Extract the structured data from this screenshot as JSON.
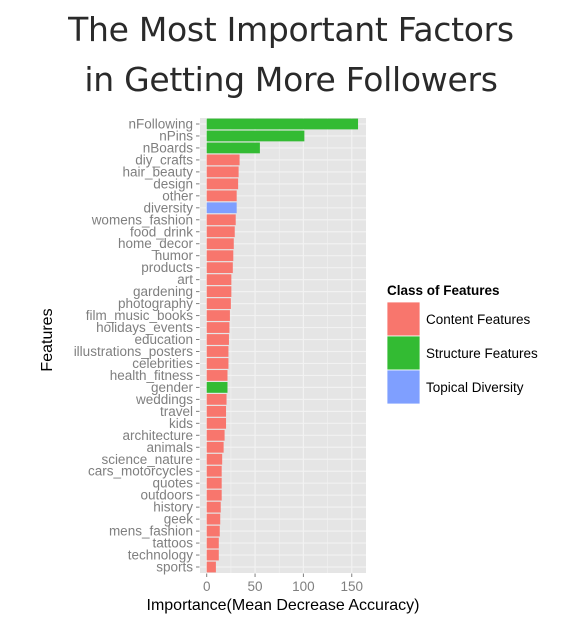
{
  "title_lines": [
    "The Most Important Factors",
    "in Getting More Followers"
  ],
  "chart_data": {
    "type": "bar",
    "orientation": "horizontal",
    "title": "The Most Important Factors in Getting More Followers",
    "xlabel": "Importance(Mean Decrease Accuracy)",
    "ylabel": "Features",
    "xlim": [
      -7,
      164
    ],
    "xticks": [
      0,
      50,
      100,
      150
    ],
    "grid": true,
    "legend": {
      "title": "Class of Features",
      "placement": "right",
      "entries": [
        {
          "name": "Content Features",
          "color": "#F8766D"
        },
        {
          "name": "Structure Features",
          "color": "#33BB33"
        },
        {
          "name": "Topical Diversity",
          "color": "#7F9FFF"
        }
      ]
    },
    "categories": [
      "nFollowing",
      "nPins",
      "nBoards",
      "diy_crafts",
      "hair_beauty",
      "design",
      "other",
      "diversity",
      "womens_fashion",
      "food_drink",
      "home_decor",
      "humor",
      "products",
      "art",
      "gardening",
      "photography",
      "film_music_books",
      "holidays_events",
      "education",
      "illustrations_posters",
      "celebrities",
      "health_fitness",
      "gender",
      "weddings",
      "travel",
      "kids",
      "architecture",
      "animals",
      "science_nature",
      "cars_motorcycles",
      "quotes",
      "outdoors",
      "history",
      "geek",
      "mens_fashion",
      "tattoos",
      "technology",
      "sports"
    ],
    "values": [
      156.5,
      101,
      55,
      34,
      33,
      32.5,
      31,
      31,
      30,
      29,
      28,
      27.5,
      27,
      25.5,
      25.5,
      25,
      24,
      23.5,
      23,
      22.5,
      22.5,
      21.5,
      21.5,
      20.5,
      20,
      20,
      18.5,
      17.5,
      16,
      15.5,
      15.5,
      15.5,
      14.5,
      14,
      13.5,
      12.5,
      12.5,
      9.5
    ],
    "classes": [
      "Structure Features",
      "Structure Features",
      "Structure Features",
      "Content Features",
      "Content Features",
      "Content Features",
      "Content Features",
      "Topical Diversity",
      "Content Features",
      "Content Features",
      "Content Features",
      "Content Features",
      "Content Features",
      "Content Features",
      "Content Features",
      "Content Features",
      "Content Features",
      "Content Features",
      "Content Features",
      "Content Features",
      "Content Features",
      "Content Features",
      "Structure Features",
      "Content Features",
      "Content Features",
      "Content Features",
      "Content Features",
      "Content Features",
      "Content Features",
      "Content Features",
      "Content Features",
      "Content Features",
      "Content Features",
      "Content Features",
      "Content Features",
      "Content Features",
      "Content Features",
      "Content Features"
    ]
  },
  "colors": {
    "panel_bg": "#E5E5E5",
    "grid": "#F2F2F2",
    "tick": "#7F7F7F"
  }
}
